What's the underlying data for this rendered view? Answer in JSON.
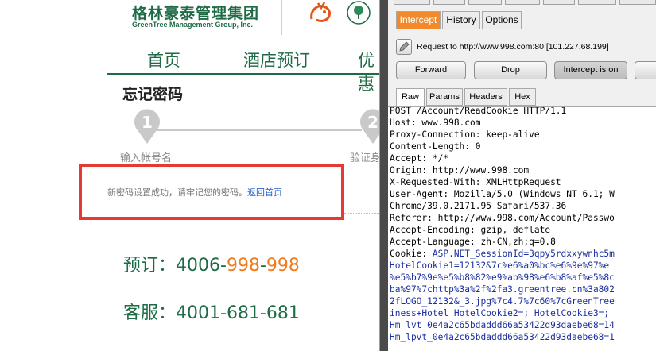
{
  "site": {
    "brand_cn": "格林豪泰管理集团",
    "brand_en": "GreenTree  Management Group, Inc.",
    "nav": [
      "首页",
      "酒店预订",
      "优惠"
    ],
    "page_title": "忘记密码",
    "steps": [
      {
        "number": "1",
        "label": "输入帐号名"
      },
      {
        "number": "2",
        "label": "验证身"
      }
    ],
    "success_message": "新密码设置成功，请牢记您的密码。",
    "back_home_link": "返回首页",
    "booking_label": "预订：",
    "booking_parts": [
      "4006-",
      "998",
      "-",
      "998"
    ],
    "service_label": "客服：",
    "service_number": "4001-681-681",
    "colors": {
      "brand_green": "#1e6b45",
      "accent_orange": "#f07a1d",
      "alert_red": "#e53935",
      "link_blue": "#2a63c8"
    }
  },
  "burp": {
    "tabs": [
      "Intercept",
      "History",
      "Options"
    ],
    "active_tab": "Intercept",
    "request_info": "Request to http://www.998.com:80  [101.227.68.199]",
    "buttons": {
      "forward": "Forward",
      "drop": "Drop",
      "intercept_toggle": "Intercept is on"
    },
    "message_tabs": [
      "Raw",
      "Params",
      "Headers",
      "Hex"
    ],
    "active_message_tab": "Raw",
    "request_lines": [
      {
        "text": "POST /Account/ReadCookie HTTP/1.1",
        "color": "black"
      },
      {
        "text": "Host: www.998.com",
        "color": "black"
      },
      {
        "text": "Proxy-Connection: keep-alive",
        "color": "black"
      },
      {
        "text": "Content-Length: 0",
        "color": "black"
      },
      {
        "text": "Accept: */*",
        "color": "black"
      },
      {
        "text": "Origin: http://www.998.com",
        "color": "black"
      },
      {
        "text": "X-Requested-With: XMLHttpRequest",
        "color": "black"
      },
      {
        "text": "User-Agent: Mozilla/5.0 (Windows NT 6.1; W",
        "color": "black"
      },
      {
        "text": "Chrome/39.0.2171.95 Safari/537.36",
        "color": "black"
      },
      {
        "text": "Referer: http://www.998.com/Account/Passwo",
        "color": "black"
      },
      {
        "text": "Accept-Encoding: gzip, deflate",
        "color": "black"
      },
      {
        "text": "Accept-Language: zh-CN,zh;q=0.8",
        "color": "black"
      },
      {
        "text": "Cookie: ",
        "color": "black",
        "rest": "ASP.NET_SessionId=3qpy5rdxxywnhc5m"
      },
      {
        "text": "HotelCookie1=12132&7c%e6%a0%bc%e6%9e%97%e",
        "color": "blue"
      },
      {
        "text": "%e5%b7%9e%e5%b8%82%e9%ab%98%e6%b8%af%e5%8c",
        "color": "blue"
      },
      {
        "text": "ba%97%7chttp%3a%2f%2fa3.greentree.cn%3a802",
        "color": "blue"
      },
      {
        "text": "2fLOGO_12132&_3.jpg%7c4.7%7c60%7cGreenTree",
        "color": "blue"
      },
      {
        "text": "iness+Hotel HotelCookie2=; HotelCookie3=;",
        "color": "blue"
      },
      {
        "text": "Hm_lvt_0e4a2c65bdaddd66a53422d93daebe68=14",
        "color": "blue"
      },
      {
        "text": "Hm_lpvt_0e4a2c65bdaddd66a53422d93daebe68=1",
        "color": "blue"
      }
    ]
  }
}
